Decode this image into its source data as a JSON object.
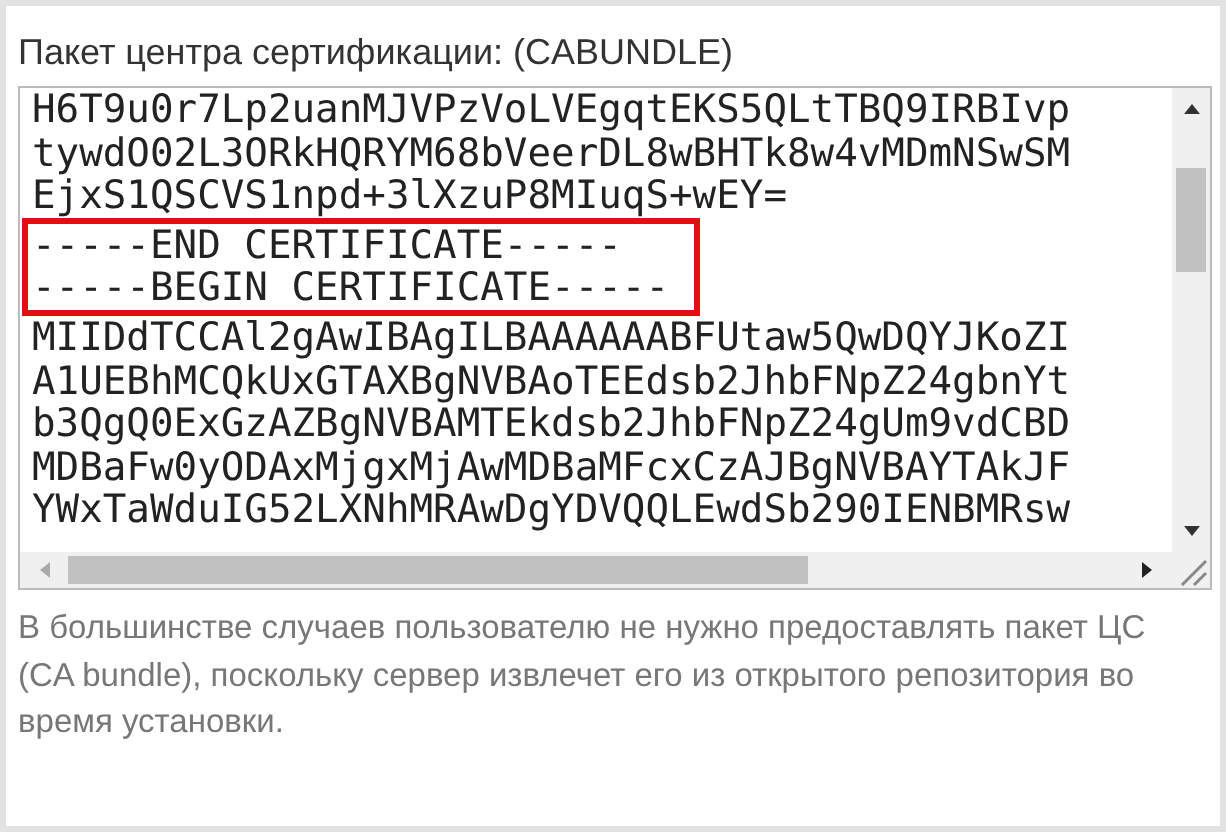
{
  "field_label": "Пакет центра сертификации: (CABUNDLE)",
  "textarea": {
    "lines": [
      {
        "text": "H6T9u0r7Lp2uanMJVPzVoLVEgqtEKS5QLtTBQ9IRBIvp",
        "highlighted": false
      },
      {
        "text": "tywdO02L3ORkHQRYM68bVeerDL8wBHTk8w4vMDmNSwSM",
        "highlighted": false
      },
      {
        "text": "EjxS1QSCVS1npd+3lXzuP8MIuqS+wEY=",
        "highlighted": false
      },
      {
        "text": "-----END CERTIFICATE-----",
        "highlighted": true
      },
      {
        "text": "-----BEGIN CERTIFICATE-----",
        "highlighted": true
      },
      {
        "text": "MIIDdTCCAl2gAwIBAgILBAAAAAABFUtaw5QwDQYJKoZI",
        "highlighted": false
      },
      {
        "text": "A1UEBhMCQkUxGTAXBgNVBAoTEEdsb2JhbFNpZ24gbnYt",
        "highlighted": false
      },
      {
        "text": "b3QgQ0ExGzAZBgNVBAMTEkdsb2JhbFNpZ24gUm9vdCBD",
        "highlighted": false
      },
      {
        "text": "MDBaFw0yODAxMjgxMjAwMDBaMFcxCzAJBgNVBAYTAkJF",
        "highlighted": false
      },
      {
        "text": "YWxTaWduIG52LXNhMRAwDgYDVQQLEwdSb290IENBMRsw",
        "highlighted": false
      }
    ]
  },
  "help_text": "В большинстве случаев пользователю не нужно предоставлять пакет ЦС (CA bundle), поскольку сервер извлечет его из открытого репозитория во время установки."
}
